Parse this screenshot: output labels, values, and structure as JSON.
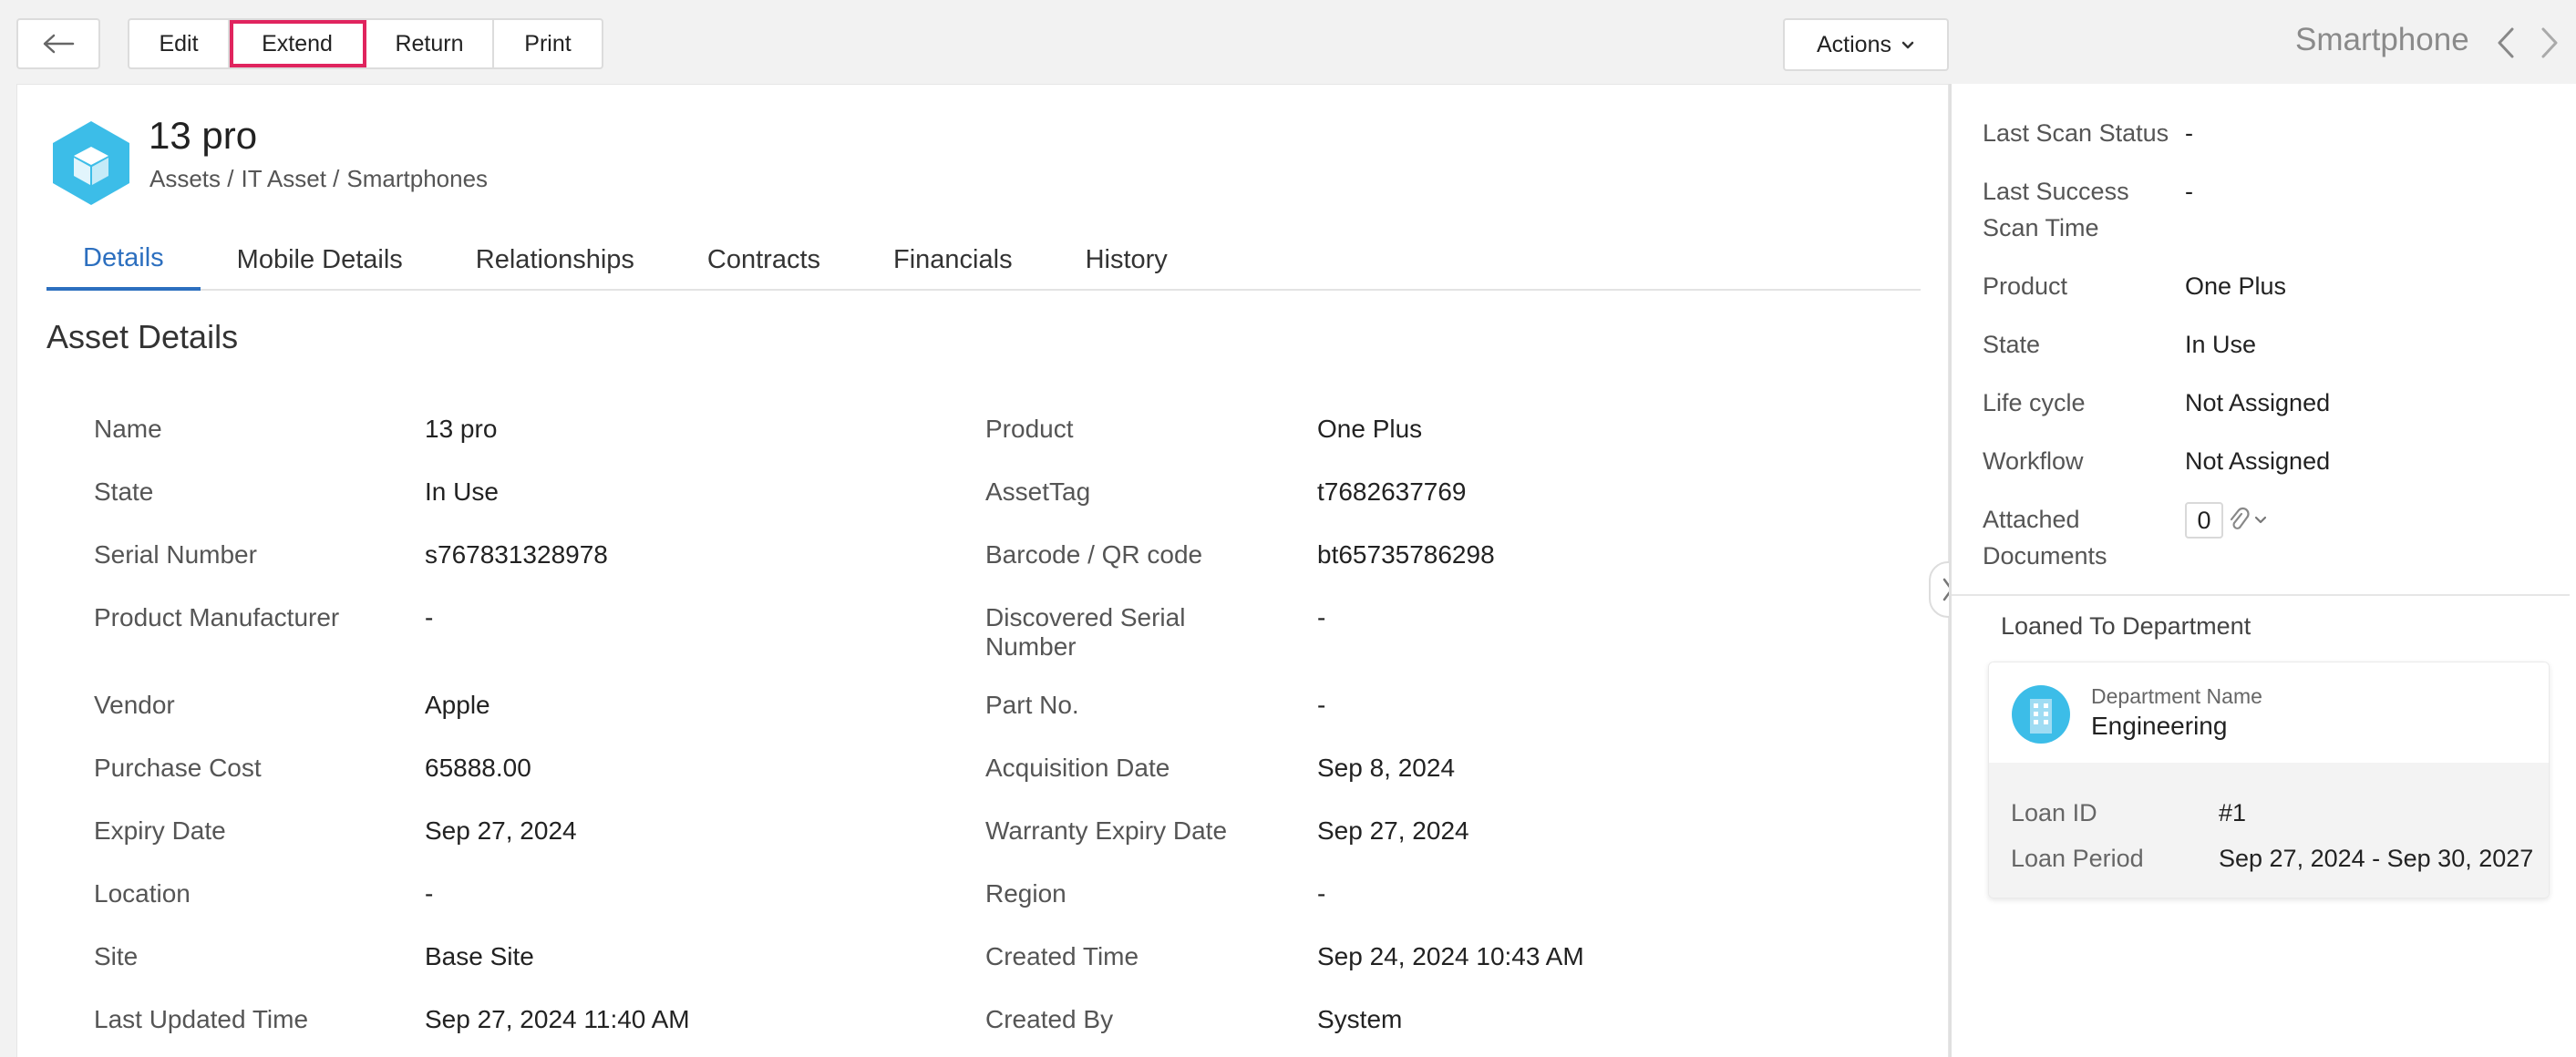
{
  "toolbar": {
    "edit_label": "Edit",
    "extend_label": "Extend",
    "return_label": "Return",
    "print_label": "Print",
    "actions_label": "Actions",
    "record_type": "Smartphone"
  },
  "header": {
    "title": "13 pro",
    "breadcrumb": [
      "Assets /",
      "IT Asset /",
      "Smartphones"
    ]
  },
  "tabs": [
    {
      "label": "Details",
      "active": true
    },
    {
      "label": "Mobile Details"
    },
    {
      "label": "Relationships"
    },
    {
      "label": "Contracts"
    },
    {
      "label": "Financials"
    },
    {
      "label": "History"
    }
  ],
  "section_title": "Asset Details",
  "details_left": [
    {
      "label": "Name",
      "value": "13 pro"
    },
    {
      "label": "State",
      "value": "In Use"
    },
    {
      "label": "Serial Number",
      "value": "s767831328978"
    },
    {
      "label": "Product Manufacturer",
      "value": "-"
    },
    {
      "label": "Vendor",
      "value": "Apple"
    },
    {
      "label": "Purchase Cost",
      "value": "65888.00"
    },
    {
      "label": "Expiry Date",
      "value": "Sep 27, 2024"
    },
    {
      "label": "Location",
      "value": "-"
    },
    {
      "label": "Site",
      "value": "Base Site"
    },
    {
      "label": "Last Updated Time",
      "value": "Sep 27, 2024 11:40 AM"
    }
  ],
  "details_right": [
    {
      "label": "Product",
      "value": "One Plus"
    },
    {
      "label": "AssetTag",
      "value": "t7682637769"
    },
    {
      "label": "Barcode / QR code",
      "value": "bt65735786298"
    },
    {
      "label_line1": "Discovered Serial",
      "label_line2": "Number",
      "value": "-"
    },
    {
      "label": "Part No.",
      "value": "-"
    },
    {
      "label": "Acquisition Date",
      "value": "Sep 8, 2024"
    },
    {
      "label": "Warranty Expiry Date",
      "value": "Sep 27, 2024"
    },
    {
      "label": "Region",
      "value": "-"
    },
    {
      "label": "Created Time",
      "value": "Sep 24, 2024 10:43 AM"
    },
    {
      "label": "Created By",
      "value": "System"
    }
  ],
  "sidebar": {
    "last_scan_status_label": "Last Scan Status",
    "last_scan_status_value": "-",
    "last_success_label_1": "Last Success",
    "last_success_label_2": "Scan Time",
    "last_success_value": "-",
    "product_label": "Product",
    "product_value": "One Plus",
    "state_label": "State",
    "state_value": "In Use",
    "lifecycle_label": "Life cycle",
    "lifecycle_value": "Not Assigned",
    "workflow_label": "Workflow",
    "workflow_value": "Not Assigned",
    "attached_label_1": "Attached",
    "attached_label_2": "Documents",
    "attached_count": "0",
    "loaned_title": "Loaned To Department",
    "department_label": "Department Name",
    "department_name": "Engineering",
    "loan_id_label": "Loan ID",
    "loan_id_value": "#1",
    "loan_period_label": "Loan Period",
    "loan_period_value": "Sep 27, 2024 - Sep 30, 2027"
  },
  "colors": {
    "accent": "#2c6fbf",
    "highlight": "#e0245e",
    "asset_icon": "#3cbde8"
  },
  "icons": {
    "back": "arrow-left-icon",
    "actions": "chevron-down-icon",
    "asset": "cube-icon",
    "nav_prev": "chevron-left-icon",
    "nav_next": "chevron-right-icon",
    "collapse": "chevron-right-icon",
    "attachment": "paperclip-icon",
    "department": "building-icon"
  }
}
